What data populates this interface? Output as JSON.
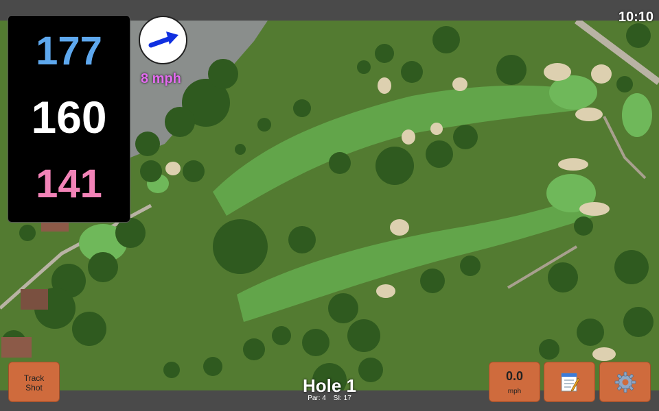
{
  "status": {
    "time": "10:10"
  },
  "distances": {
    "back": "177",
    "middle": "160",
    "front": "141"
  },
  "wind": {
    "speed_text": "8 mph",
    "direction_icon": "arrow-right-icon"
  },
  "hole": {
    "title": "Hole 1",
    "par": "Par: 4",
    "stroke_index": "SI: 17"
  },
  "buttons": {
    "track_line1": "Track",
    "track_line2": "Shot",
    "speed_value": "0.0",
    "speed_unit": "mph",
    "notes_icon": "notepad-icon",
    "settings_icon": "gear-icon"
  },
  "colors": {
    "back": "#5ea8ee",
    "middle": "#ffffff",
    "front": "#f283b7",
    "wind_text": "#e46cf0",
    "button_bg": "#cf6b3d",
    "bar_bg": "#4a4a4a"
  }
}
